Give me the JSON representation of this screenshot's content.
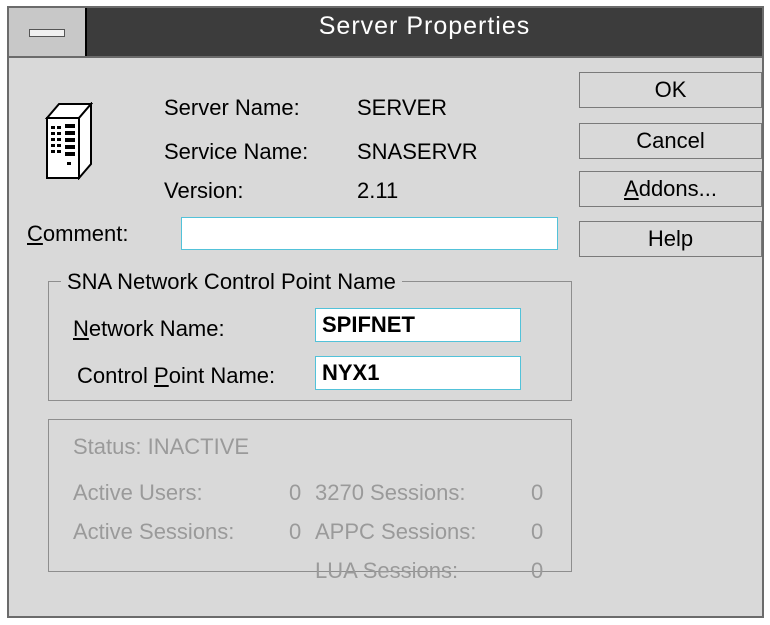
{
  "window": {
    "title": "Server Properties"
  },
  "info": {
    "server_name_label": "Server Name:",
    "server_name_value": "SERVER",
    "service_name_label": "Service Name:",
    "service_name_value": "SNASERVR",
    "version_label": "Version:",
    "version_value": "2.11"
  },
  "comment": {
    "label_mnemonic": "C",
    "label_rest": "omment:",
    "value": ""
  },
  "buttons": {
    "ok": "OK",
    "cancel": "Cancel",
    "addons_mnemonic": "A",
    "addons_rest": "ddons...",
    "help": "Help"
  },
  "cp_group": {
    "title": "SNA Network Control Point Name",
    "network_label_mnemonic": "N",
    "network_label_rest": "etwork Name:",
    "network_value": "SPIFNET",
    "cp_label_pre": "Control ",
    "cp_label_mnemonic": "P",
    "cp_label_rest": "oint Name:",
    "cp_value": "NYX1"
  },
  "status": {
    "status_text": "Status: INACTIVE",
    "active_users_label": "Active Users:",
    "active_users_value": "0",
    "active_sessions_label": "Active Sessions:",
    "active_sessions_value": "0",
    "s3270_label": "3270 Sessions:",
    "s3270_value": "0",
    "appc_label": "APPC Sessions:",
    "appc_value": "0",
    "lua_label": "LUA Sessions:",
    "lua_value": "0"
  },
  "colors": {
    "background": "#d9d9d9",
    "titlebar": "#3c3c3c",
    "disabled_text": "#9a9a9a",
    "input_border": "#52c2d9"
  },
  "icons": {
    "system_menu": "system-menu-icon",
    "server": "server-icon"
  }
}
